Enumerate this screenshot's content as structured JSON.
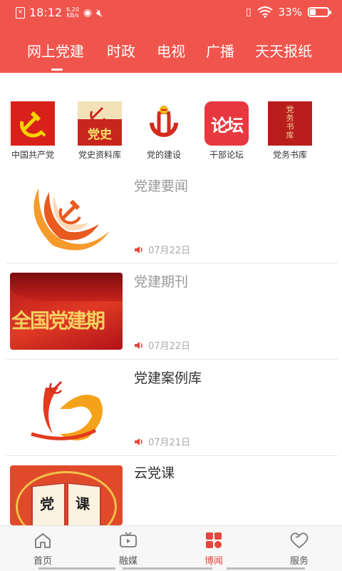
{
  "status_bar": {
    "time": "18:12",
    "net_speed": "6.20",
    "net_unit": "KB/s",
    "battery_text": "33%",
    "battery_level": 0.33
  },
  "tabs": [
    {
      "label": "网上党建",
      "active": true
    },
    {
      "label": "时政",
      "active": false
    },
    {
      "label": "电视",
      "active": false
    },
    {
      "label": "广播",
      "active": false
    },
    {
      "label": "天天报纸",
      "active": false
    }
  ],
  "shortcuts": [
    {
      "label": "中国共产党",
      "icon": "party-flag-icon"
    },
    {
      "label": "党史资料库",
      "icon": "party-history-icon",
      "icon_text": "党史"
    },
    {
      "label": "党的建设",
      "icon": "party-building-icon"
    },
    {
      "label": "干部论坛",
      "icon": "forum-icon",
      "icon_text": "论坛"
    },
    {
      "label": "党务书库",
      "icon": "book-library-icon",
      "icon_text": "党务书库"
    }
  ],
  "news": [
    {
      "title": "党建要闻",
      "date": "07月22日",
      "read": true,
      "thumb": "party-emblem-swirl"
    },
    {
      "title": "党建期刊",
      "date": "07月22日",
      "read": true,
      "thumb": "red-banner",
      "thumb_text": "全国党建期"
    },
    {
      "title": "党建案例库",
      "date": "07月21日",
      "read": false,
      "thumb": "party-90-logo"
    },
    {
      "title": "云党课",
      "date": "",
      "read": false,
      "thumb": "open-book",
      "thumb_text_left": "党",
      "thumb_text_right": "课"
    }
  ],
  "bottom_nav": [
    {
      "label": "首页",
      "icon": "home-icon",
      "active": false
    },
    {
      "label": "融媒",
      "icon": "tv-icon",
      "active": false
    },
    {
      "label": "博闻",
      "icon": "grid-icon",
      "active": true
    },
    {
      "label": "服务",
      "icon": "heart-icon",
      "active": false
    }
  ],
  "colors": {
    "brand_red": "#f0554d",
    "active_nav": "#e8453c",
    "inactive_nav": "#555555",
    "title_unread": "#333333",
    "title_read": "#999999"
  }
}
